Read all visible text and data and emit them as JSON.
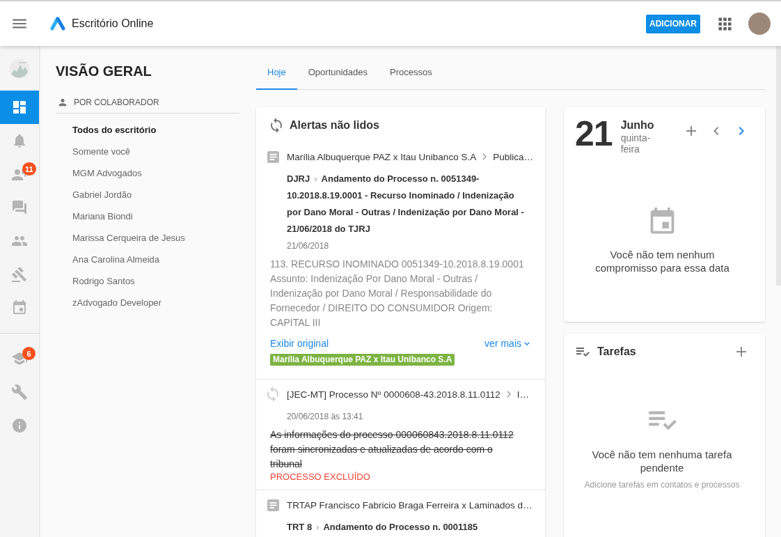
{
  "top_bar": {
    "title": "Escritório Online",
    "add_button": "ADICIONAR"
  },
  "nav_rail": {
    "items": [
      {
        "selected": true
      },
      {
        "selected": false
      },
      {
        "selected": false,
        "badge": "11"
      },
      {
        "selected": false
      },
      {
        "selected": false
      },
      {
        "selected": false
      },
      {
        "selected": false
      }
    ],
    "bottom_items": [
      {
        "selected": false,
        "badge": "6"
      },
      {
        "selected": false
      },
      {
        "selected": false
      }
    ]
  },
  "sidebar": {
    "title": "VISÃO GERAL",
    "section": "POR COLABORADOR",
    "items": [
      {
        "label": "Todos do escritório",
        "selected": true
      },
      {
        "label": "Somente você",
        "selected": false
      },
      {
        "label": "MGM Advogados",
        "selected": false
      },
      {
        "label": "Gabriel Jordão",
        "selected": false
      },
      {
        "label": "Mariana Biondi",
        "selected": false
      },
      {
        "label": "Marissa Cerqueira de Jesus",
        "selected": false
      },
      {
        "label": "Ana Carolina Almeida",
        "selected": false
      },
      {
        "label": "Rodrigo Santos",
        "selected": false
      },
      {
        "label": "zAdvogado Developer",
        "selected": false
      }
    ]
  },
  "tabs": [
    {
      "label": "Hoje",
      "selected": true
    },
    {
      "label": "Oportunidades",
      "selected": false
    },
    {
      "label": "Processos",
      "selected": false
    }
  ],
  "alerts": {
    "title": "Alertas não lidos",
    "items": [
      {
        "kind": "publication",
        "title": "Marília Albuquerque PAZ x Itau Unibanco S.A",
        "category": "Publica…",
        "source": "DJRJ",
        "separator": "›",
        "headline": "Andamento do Processo n. 0051349-10.2018.8.19.0001 - Recurso Inominado / Indenização por Dano Moral - Outras / Indenização por Dano Moral - 21/06/2018 do TJRJ",
        "date": "21/06/2018",
        "body": "113. RECURSO INOMINADO 0051349-10.2018.8.19.0001 Assunto: Indenização Por Dano Moral - Outras / Indenização por Dano Moral / Responsabilidade do Fornecedor / DIREITO DO CONSUMIDOR Origem: CAPITAL III",
        "struck": false,
        "link": "Exibir original",
        "more": "ver mais",
        "tag": "Marília Albuquerque PAZ x Itau Unibanco S.A"
      },
      {
        "kind": "sync",
        "title": "[JEC-MT] Processo Nº 0000608-43.2018.8.11.0112",
        "category": "I…",
        "date": "20/06/2018 às 13:41",
        "body": "As informações do processo 000060843.2018.8.11.0112 foram sincronizadas e atualizadas de acordo com o tribunal",
        "struck": true,
        "status": "PROCESSO EXCLUÍDO"
      },
      {
        "kind": "publication",
        "title": "TRTAP Francisco Fabricio Braga Ferreira x Laminados d…",
        "source": "TRT 8",
        "separator": "›",
        "headline": "Andamento do Processo n. 0001185"
      }
    ]
  },
  "calendar": {
    "day": "21",
    "month": "Junho",
    "weekday": "quinta-feira",
    "empty_text": "Você não tem nenhum compromisso para essa data"
  },
  "tasks": {
    "title": "Tarefas",
    "empty_text": "Você não tem nenhuma tarefa pendente",
    "hint": "Adicione tarefas em contatos e processos"
  }
}
